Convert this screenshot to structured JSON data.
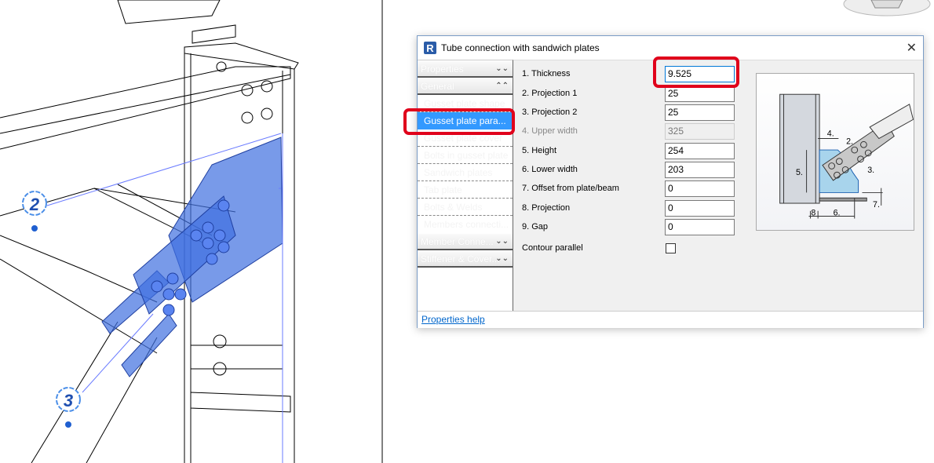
{
  "viewport": {
    "markers": [
      "2",
      "3"
    ]
  },
  "dialog": {
    "title": "Tube connection with sandwich plates",
    "close_icon": "close-icon",
    "sidebar": {
      "headers": [
        {
          "label": "Properties",
          "state": "collapsed"
        },
        {
          "label": "General",
          "state": "expanded"
        }
      ],
      "items": [
        {
          "label": "Gusset plate shape"
        },
        {
          "label": "Gusset plate para...",
          "selected": true
        },
        {
          "label": "Gusset plate cover"
        },
        {
          "label": "Bolts in gusset plate"
        },
        {
          "label": "Sandwich plates"
        },
        {
          "label": "Tab plate"
        },
        {
          "label": "Bolts & Welds"
        },
        {
          "label": "Members connecti..."
        }
      ],
      "bottom_headers": [
        {
          "label": "Member Conne..."
        },
        {
          "label": "Stiffener & Cover..."
        }
      ]
    },
    "fields": [
      {
        "label": "1. Thickness",
        "value": "9.525",
        "focused": true
      },
      {
        "label": "2. Projection 1",
        "value": "25"
      },
      {
        "label": "3. Projection 2",
        "value": "25"
      },
      {
        "label": "4. Upper width",
        "value": "325",
        "disabled": true
      },
      {
        "label": "5. Height",
        "value": "254"
      },
      {
        "label": "6. Lower width",
        "value": "203"
      },
      {
        "label": "7. Offset from plate/beam",
        "value": "0"
      },
      {
        "label": "8. Projection",
        "value": "0"
      },
      {
        "label": "9. Gap",
        "value": "0"
      }
    ],
    "contour_parallel": {
      "label": "Contour parallel",
      "checked": false
    },
    "diagram_labels": [
      "2.",
      "3.",
      "4.",
      "5.",
      "6.",
      "7.",
      "8"
    ],
    "help_link": "Properties help",
    "accent": "#3399ff",
    "highlight": "#e0001b"
  }
}
